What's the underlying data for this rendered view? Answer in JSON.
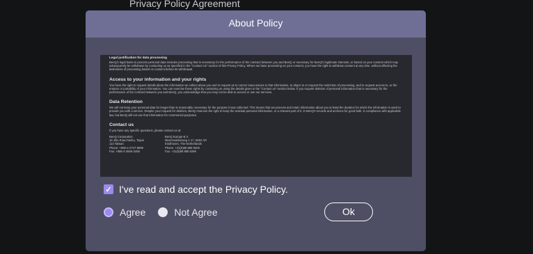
{
  "background": {
    "caption": "Privacy Policy Agreement"
  },
  "dialog": {
    "title": "About Policy",
    "document": {
      "legal_heading": "Legal justification for data processing",
      "legal_text": "BenQ's legal basis to process personal data includes processing that is necessary for the performance of the contract between you and BenQ or necessary for BenQ's legitimate interests, or based on your consent which may subsequently be withdrawn by contacting us as specified in the \"Contact Us\" section of this Privacy Policy. Where we base processing on your consent, you have the right to withdraw consent at any time, without affecting the lawfulness of processing based on consent before its withdrawal.",
      "rights_heading": "Access to your information and your rights",
      "rights_text": "You have the right to request details about the information we collect about you and to request as to correct inaccuracies in that information, to object to or request the restriction of processing, and to request access to, or the erasure or portability of your information. You can exercise these rights by contacting us using the details given in the \"Contact us\" section below. If you request deletion of personal information that is necessary for the performance of the contract between you and BenQ, you acknowledge that you may not be able to access or use our services.",
      "retention_heading": "Data Retention",
      "retention_text": "We will not keep your personal data for longer than is reasonably necessary for the purpose it was collected. This means that we process and retain information about you at least the duration for which the information is used to provide you with a service. Despite your request for deletion, BenQ reserves the right to keep the residual personal information, or a relevant part of it, in BenQ's records and archives for good faith, in compliance with applicable law, but BenQ will not use that information for commercial purposes.",
      "contact_heading": "Contact us",
      "contact_intro": "If you have any specific questions, please contact us at:",
      "contact_left": {
        "line1": "BenQ Corporation",
        "line2": "16 Jihu Road Neihu, Taipei",
        "line3": "114 Taiwan",
        "line4": "Phone: +886-2-2727-8899",
        "line5": "Fax: +886-2-2656-2458"
      },
      "contact_right": {
        "line1": "BenQ Europe B.V.",
        "line2": "Meerenakkerweg 1-17, 5652 AR",
        "line3": "Eindhoven, The Netherlands",
        "line4": "Phone: +31(0)88 888 9200",
        "line5": "Fax: +31(0)88 888 9299"
      }
    },
    "accept_checkbox": {
      "checked": true,
      "label": "I've read and accept the Privacy Policy."
    },
    "agree_option": {
      "label": "Agree",
      "selected": true
    },
    "not_agree_option": {
      "label": "Not Agree",
      "selected": false
    },
    "ok_button": {
      "label": "Ok"
    }
  },
  "colors": {
    "dialog_body": "#4e4f64",
    "dialog_header": "#6f6f96",
    "accent": "#9b8af0",
    "document_bg": "#27292e",
    "screen_bg": "#121416"
  }
}
